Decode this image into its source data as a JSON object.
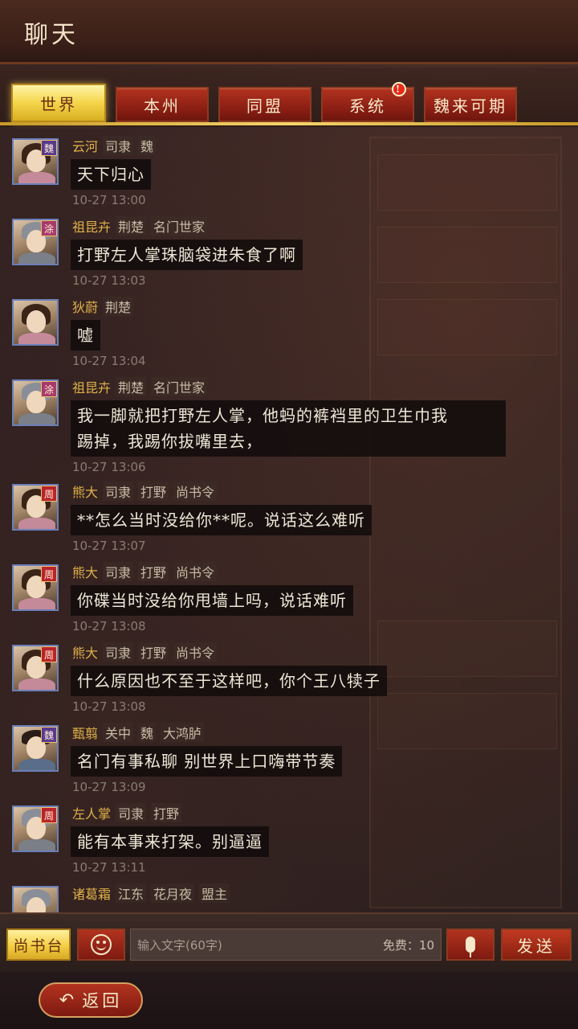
{
  "header": {
    "title": "聊天"
  },
  "tabs": [
    {
      "label": "世界",
      "active": true
    },
    {
      "label": "本州",
      "active": false
    },
    {
      "label": "同盟",
      "active": false
    },
    {
      "label": "系统",
      "active": false,
      "badge": "!"
    },
    {
      "label": "魏来可期",
      "active": false
    }
  ],
  "messages": [
    {
      "name": "云河",
      "tags": [
        "司隶",
        "魏"
      ],
      "kingdom": "魏",
      "text": "天下归心",
      "time": "10-27 13:00"
    },
    {
      "name": "祖昆卉",
      "tags": [
        "荆楚",
        "名门世家"
      ],
      "kingdom": "涂",
      "text": "打野左人掌珠脑袋进朱食了啊",
      "time": "10-27 13:03"
    },
    {
      "name": "狄蔚",
      "tags": [
        "荆楚"
      ],
      "kingdom": "",
      "text": "嘘",
      "time": "10-27 13:04"
    },
    {
      "name": "祖昆卉",
      "tags": [
        "荆楚",
        "名门世家"
      ],
      "kingdom": "涂",
      "text_lines": [
        "我一脚就把打野左人掌，他蚂的裤裆里的卫生巾我",
        "踢掉，我踢你拔嘴里去，"
      ],
      "time": "10-27 13:06"
    },
    {
      "name": "熊大",
      "tags": [
        "司隶",
        "打野",
        "尚书令"
      ],
      "kingdom": "周",
      "text": "**怎么当时没给你**呢。说话这么难听",
      "time": "10-27 13:07"
    },
    {
      "name": "熊大",
      "tags": [
        "司隶",
        "打野",
        "尚书令"
      ],
      "kingdom": "周",
      "text": "你碟当时没给你甩墙上吗，说话难听",
      "time": "10-27 13:08"
    },
    {
      "name": "熊大",
      "tags": [
        "司隶",
        "打野",
        "尚书令"
      ],
      "kingdom": "周",
      "text": "什么原因也不至于这样吧，你个王八犊子",
      "time": "10-27 13:08"
    },
    {
      "name": "甄翦",
      "tags": [
        "关中",
        "魏",
        "大鸿胪"
      ],
      "kingdom": "魏",
      "text": "名门有事私聊 别世界上口嗨带节奏",
      "time": "10-27 13:09"
    },
    {
      "name": "左人掌",
      "tags": [
        "司隶",
        "打野"
      ],
      "kingdom": "周",
      "text": "能有本事来打架。别逼逼",
      "time": "10-27 13:11"
    },
    {
      "name": "诸葛霜",
      "tags": [
        "江东",
        "花月夜",
        "盟主"
      ],
      "kingdom": "",
      "text": "",
      "time": ""
    }
  ],
  "input": {
    "channel_label": "尚书台",
    "placeholder": "输入文字(60字)",
    "quota_label": "免费：10",
    "send_label": "发送"
  },
  "footer": {
    "back_label": "返回"
  },
  "icons": {
    "emoji": "smiley-icon",
    "mic": "microphone-icon",
    "back": "back-arrow-icon"
  },
  "colors": {
    "active_tab": "#f4d54a",
    "tab": "#9a2618",
    "name": "#e0b24a",
    "bubble": "#120c0c"
  }
}
